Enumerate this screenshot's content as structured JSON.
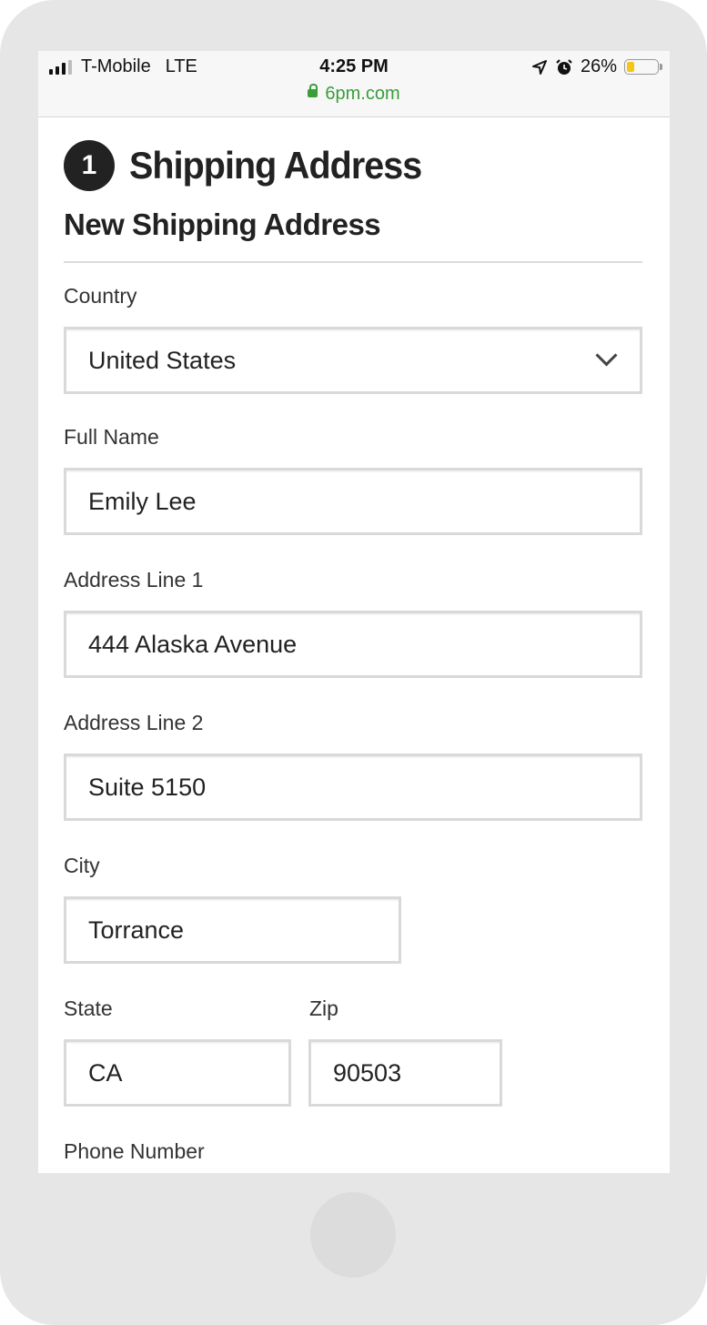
{
  "status_bar": {
    "carrier": "T-Mobile",
    "network": "LTE",
    "time": "4:25 PM",
    "battery_percent_label": "26%",
    "battery_level": 0.26,
    "battery_color": "#f5c518",
    "location_icon": "location-arrow-icon",
    "alarm_icon": "alarm-clock-icon"
  },
  "browser": {
    "url": "6pm.com",
    "url_color": "#3a9d3a"
  },
  "checkout": {
    "step_number": "1",
    "section_title": "Shipping Address",
    "subtitle": "New Shipping Address"
  },
  "form": {
    "country": {
      "label": "Country",
      "value": "United States"
    },
    "full_name": {
      "label": "Full Name",
      "value": "Emily Lee"
    },
    "address_line_1": {
      "label": "Address Line 1",
      "value": "444 Alaska Avenue"
    },
    "address_line_2": {
      "label": "Address Line 2",
      "value": "Suite 5150"
    },
    "city": {
      "label": "City",
      "value": "Torrance"
    },
    "state": {
      "label": "State",
      "value": "CA"
    },
    "zip": {
      "label": "Zip",
      "value": "90503"
    },
    "phone_number": {
      "label": "Phone Number"
    }
  }
}
